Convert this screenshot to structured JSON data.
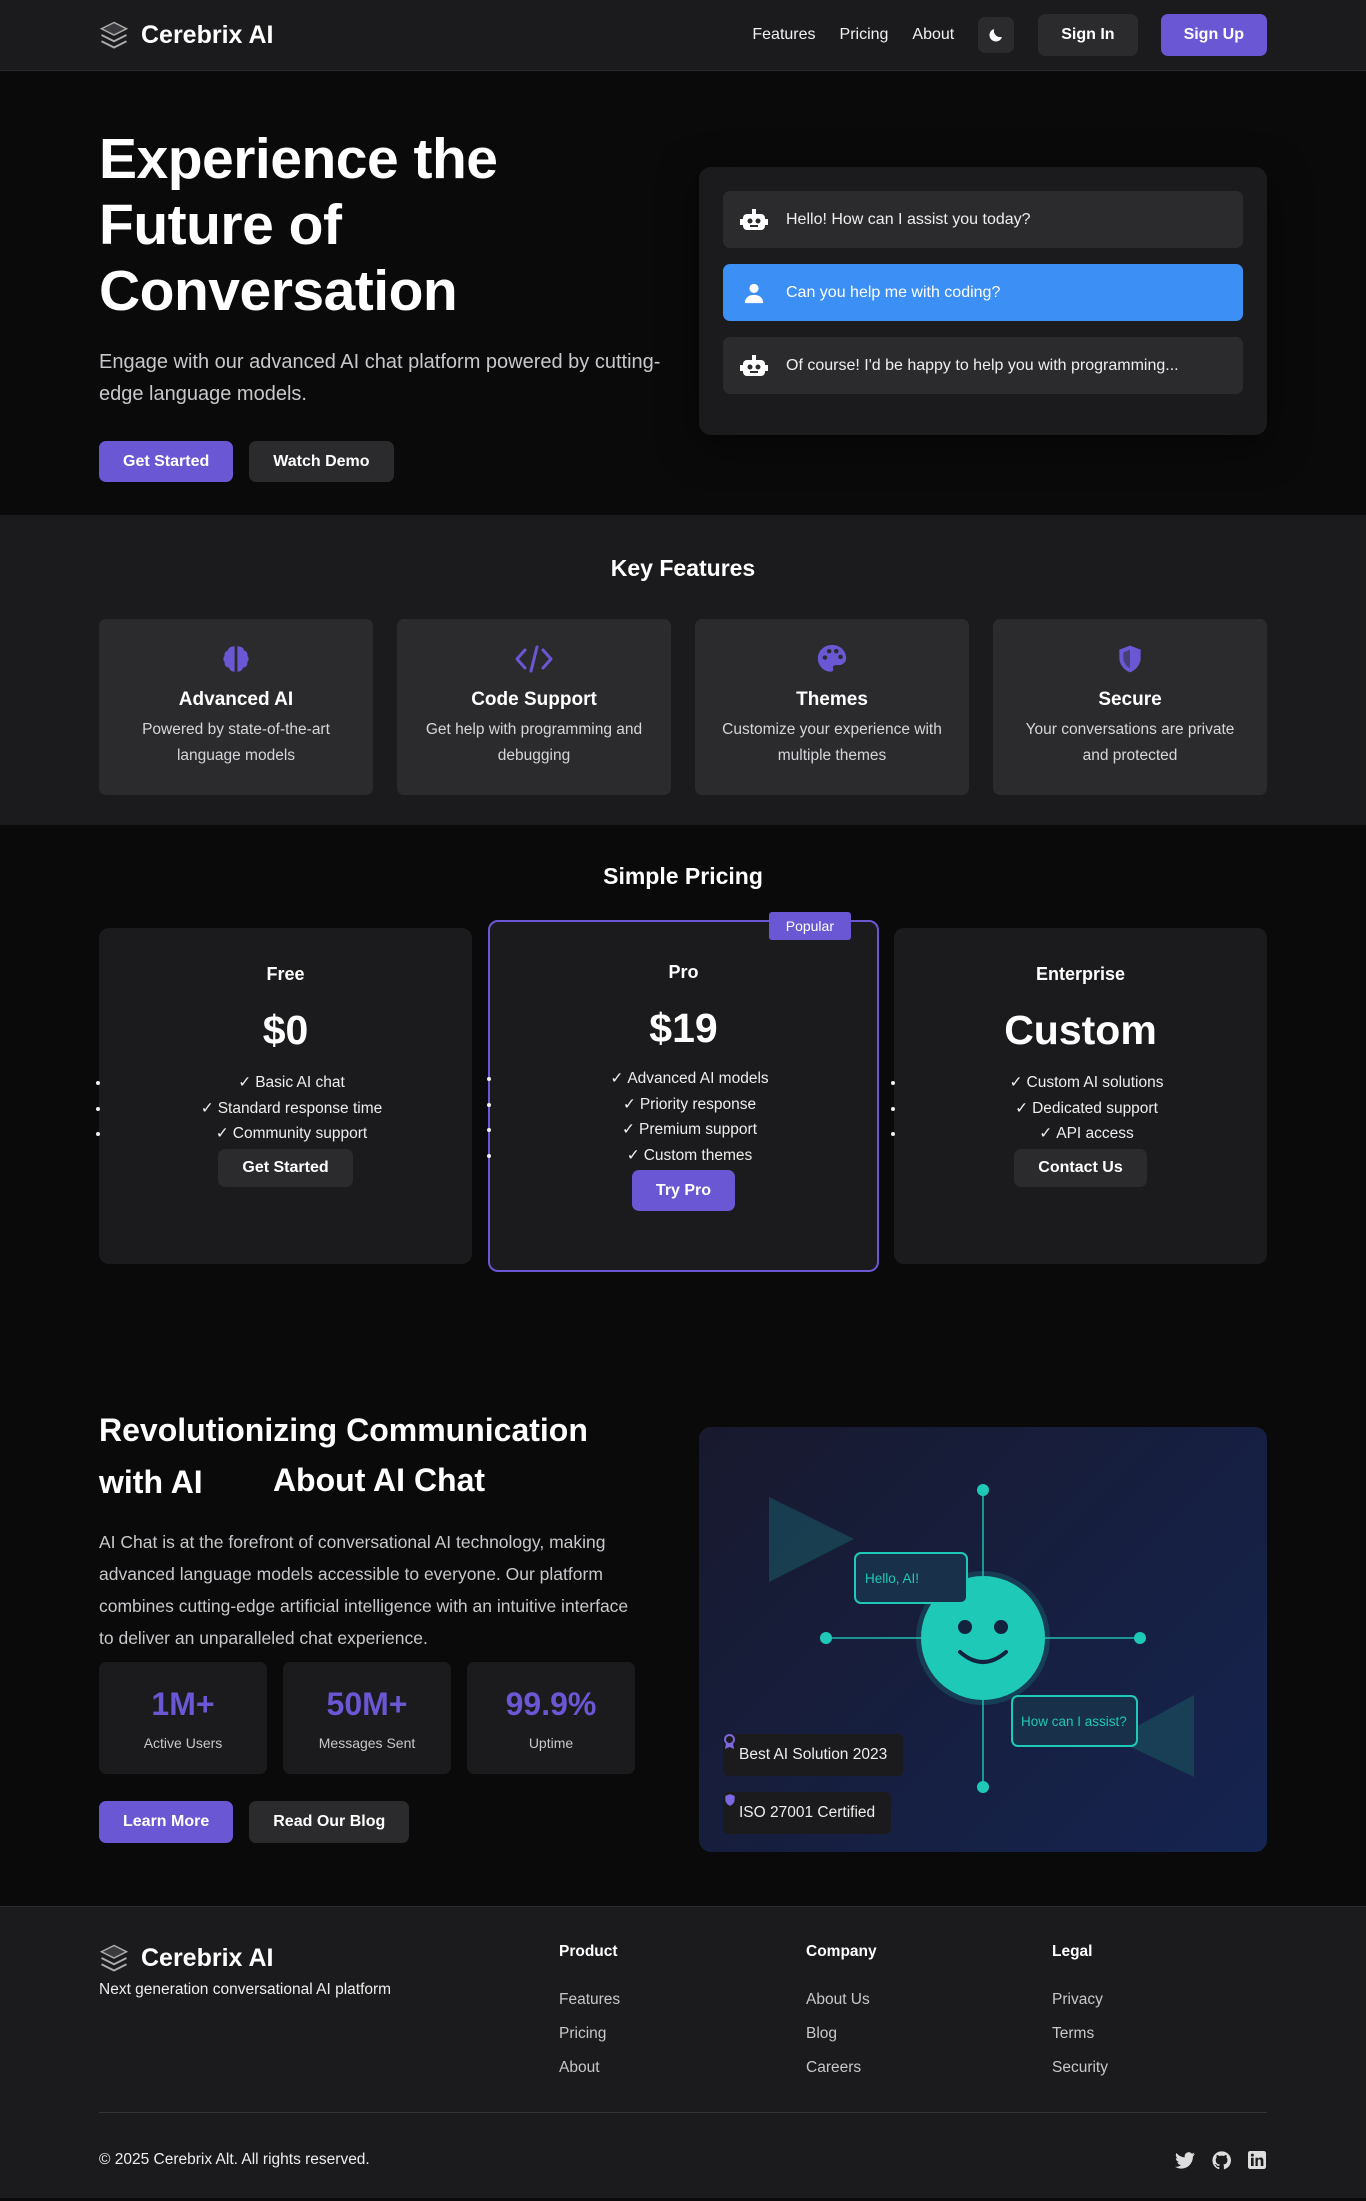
{
  "brand": {
    "name": "Cerebrix AI"
  },
  "nav": {
    "links": [
      "Features",
      "Pricing",
      "About"
    ],
    "sign_in": "Sign In",
    "sign_up": "Sign Up"
  },
  "hero": {
    "title": "Experience the Future of Conversation",
    "subtitle": "Engage with our advanced AI chat platform powered by cutting-edge language models.",
    "primary_cta": "Get Started",
    "secondary_cta": "Watch Demo",
    "chat": [
      {
        "role": "bot",
        "icon": "robot-icon",
        "text": "Hello! How can I assist you today?"
      },
      {
        "role": "user",
        "icon": "user-icon",
        "text": "Can you help me with coding?"
      },
      {
        "role": "bot",
        "icon": "robot-icon",
        "text": "Of course! I'd be happy to help you with programming..."
      }
    ]
  },
  "features": {
    "title": "Key Features",
    "items": [
      {
        "icon": "brain-icon",
        "title": "Advanced AI",
        "desc": "Powered by state-of-the-art language models"
      },
      {
        "icon": "code-icon",
        "title": "Code Support",
        "desc": "Get help with programming and debugging"
      },
      {
        "icon": "palette-icon",
        "title": "Themes",
        "desc": "Customize your experience with multiple themes"
      },
      {
        "icon": "shield-icon",
        "title": "Secure",
        "desc": "Your conversations are private and protected"
      }
    ]
  },
  "pricing": {
    "title": "Simple Pricing",
    "plans": [
      {
        "name": "Free",
        "price": "$0",
        "features": [
          "Basic AI chat",
          "Standard response time",
          "Community support"
        ],
        "cta": "Get Started"
      },
      {
        "name": "Pro",
        "price": "$19",
        "badge": "Popular",
        "features": [
          "Advanced AI models",
          "Priority response",
          "Premium support",
          "Custom themes"
        ],
        "cta": "Try Pro"
      },
      {
        "name": "Enterprise",
        "price": "Custom",
        "features": [
          "Custom AI solutions",
          "Dedicated support",
          "API access"
        ],
        "cta": "Contact Us"
      }
    ]
  },
  "about": {
    "title": "About AI Chat",
    "heading": "Revolutionizing Communication with AI",
    "desc": "AI Chat is at the forefront of conversational AI technology, making advanced language models accessible to everyone. Our platform combines cutting-edge artificial intelligence with an intuitive interface to deliver an unparalleled chat experience.",
    "stats": [
      {
        "value": "1M+",
        "label": "Active Users"
      },
      {
        "value": "50M+",
        "label": "Messages Sent"
      },
      {
        "value": "99.9%",
        "label": "Uptime"
      }
    ],
    "primary_cta": "Learn More",
    "secondary_cta": "Read Our Blog",
    "bubble_1": "Hello, AI!",
    "bubble_2": "How can I assist?",
    "awards": [
      {
        "icon": "award-icon",
        "text": "Best AI Solution 2023"
      },
      {
        "icon": "shield-icon",
        "text": "ISO 27001 Certified"
      }
    ]
  },
  "footer": {
    "tagline": "Next generation conversational AI platform",
    "columns": [
      {
        "title": "Product",
        "links": [
          "Features",
          "Pricing",
          "About"
        ]
      },
      {
        "title": "Company",
        "links": [
          "About Us",
          "Blog",
          "Careers"
        ]
      },
      {
        "title": "Legal",
        "links": [
          "Privacy",
          "Terms",
          "Security"
        ]
      }
    ],
    "copyright": "© 2025 Cerebrix Alt. All rights reserved.",
    "social": [
      "twitter-icon",
      "github-icon",
      "linkedin-icon"
    ]
  },
  "colors": {
    "accent": "#6a57d3",
    "user_bubble": "#3b8ff5",
    "teal": "#1ec9b7"
  }
}
